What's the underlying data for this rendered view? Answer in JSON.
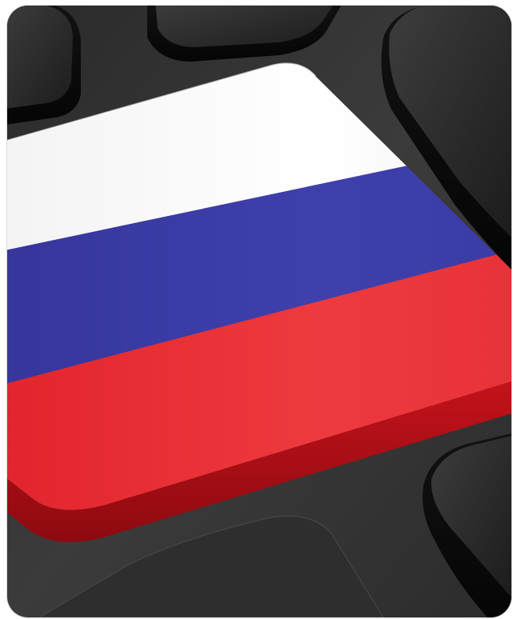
{
  "image": {
    "subject": "keyboard-key-with-russian-flag",
    "colors": {
      "keyboard_dark": "#1b1b1b",
      "keyboard_mid": "#3a3a3a",
      "flag_white": "#f7f7f7",
      "flag_blue": "#3c3ca6",
      "flag_red": "#e8242c",
      "frame_border": "#d9dde3"
    }
  }
}
